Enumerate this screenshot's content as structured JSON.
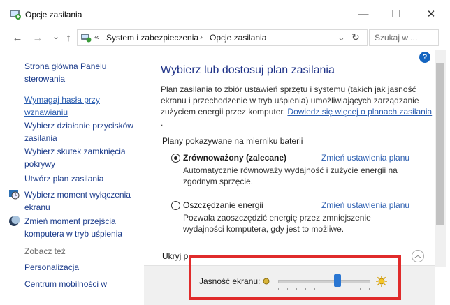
{
  "window": {
    "title": "Opcje zasilania",
    "minimize": "—",
    "maximize": "☐",
    "close": "✕"
  },
  "nav": {
    "back": "←",
    "forward": "→",
    "dropdown": "⌄",
    "up": "↑",
    "breadcrumb_sep": "«",
    "crumb1": "System i zabezpieczenia",
    "crumb_sep": "›",
    "crumb2": "Opcje zasilania",
    "refresh": "↻",
    "search_placeholder": "Szukaj w ..."
  },
  "sidebar": {
    "home": [
      "Strona główna Panelu",
      "sterowania"
    ],
    "items": [
      {
        "lines": [
          "Wymagaj hasła przy",
          "wznawianiu"
        ]
      },
      {
        "lines": [
          "Wybierz działanie przycisków",
          "zasilania"
        ]
      },
      {
        "lines": [
          "Wybierz skutek zamknięcia",
          "pokrywy"
        ]
      },
      {
        "lines": [
          "Utwórz plan zasilania"
        ]
      },
      {
        "lines": [
          "Wybierz moment wyłączenia",
          "ekranu"
        ]
      },
      {
        "lines": [
          "Zmień moment przejścia",
          "komputera w tryb uśpienia"
        ]
      }
    ],
    "see_also": "Zobacz też",
    "also_items": [
      "Personalizacja",
      "Centrum mobilności w"
    ]
  },
  "main": {
    "heading": "Wybierz lub dostosuj plan zasilania",
    "desc": "Plan zasilania to zbiór ustawień sprzętu i systemu (takich jak jasność ekranu i przechodzenie w tryb uśpienia) umożliwiających zarządzanie zużyciem energii przez komputer.",
    "desc_link": "Dowiedz się więcej o planach zasilania",
    "desc_tail": ".",
    "group_label": "Plany pokazywane na mierniku baterii",
    "plans": [
      {
        "name": "Zrównoważony (zalecane)",
        "link": "Zmień ustawienia planu",
        "desc": "Automatycznie równoważy wydajność i zużycie energii na zgodnym sprzęcie.",
        "selected": true
      },
      {
        "name": "Oszczędzanie energii",
        "link": "Zmień ustawienia planu",
        "desc": "Pozwala zaoszczędzić energię przez zmniejszenie wydajności komputera, gdy jest to możliwe.",
        "selected": false
      }
    ],
    "hide_label": "Ukryj p",
    "toggle_glyph": "︿"
  },
  "brightness": {
    "label": "Jasność ekranu:",
    "value_fraction": 0.65
  },
  "colors": {
    "link": "#2a5db0",
    "heading": "#1e3287",
    "highlight": "#e02b2b",
    "slider": "#2a76d2"
  },
  "help": "?"
}
